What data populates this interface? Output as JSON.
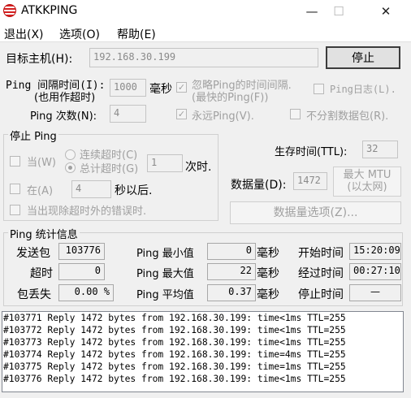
{
  "window": {
    "title": "ATKKPING",
    "minimize_glyph": "—",
    "maximize_glyph": "☐",
    "close_glyph": "✕"
  },
  "menu": {
    "exit": "退出(X)",
    "options": "选项(O)",
    "help": "帮助(E)"
  },
  "target": {
    "label": "目标主机(H):",
    "value": "192.168.30.199",
    "stop_button": "停止"
  },
  "interval": {
    "label_line1": "Ping 间隔时间(I):",
    "label_line2": "(也用作超时)",
    "value": "1000",
    "unit": "毫秒",
    "ignore_line1": "忽略Ping的时间间隔.",
    "ignore_line2": "(最快的Ping(F))",
    "ping_log": "Ping日志(L)."
  },
  "count": {
    "label": "Ping 次数(N):",
    "value": "4",
    "forever": "永远Ping(V).",
    "no_fragment": "不分割数据包(R)."
  },
  "stop_ping": {
    "group_title": "停止 Ping",
    "when": "当(W)",
    "consecutive_timeout": "连续超时(C)",
    "total_timeout": "总计超时(G)",
    "timeout_value": "1",
    "times": "次时.",
    "at": "在(A)",
    "at_value": "4",
    "seconds_after": "秒以后.",
    "on_error": "当出现除超时外的错误时."
  },
  "ttl": {
    "label": "生存时间(TTL):",
    "value": "32"
  },
  "data": {
    "label": "数据量(D):",
    "value": "1472",
    "max_mtu_line1": "最大 MTU",
    "max_mtu_line2": "(以太网)",
    "options_button": "数据量选项(Z)..."
  },
  "stats": {
    "group_title": "Ping  统计信息",
    "sent_label": "发送包",
    "sent_value": "103776",
    "timeout_label": "超时",
    "timeout_value": "0",
    "loss_label": "包丢失",
    "loss_value": "0.00 %",
    "min_label": "Ping 最小值",
    "min_value": "0",
    "max_label": "Ping 最大值",
    "max_value": "22",
    "avg_label": "Ping 平均值",
    "avg_value": "0.37",
    "ms_unit": "毫秒",
    "start_label": "开始时间",
    "start_value": "15:20:09",
    "elapsed_label": "经过时间",
    "elapsed_value": "00:27:10",
    "stop_label": "停止时间",
    "stop_value": "—"
  },
  "log": {
    "lines": [
      "#103771 Reply 1472 bytes from 192.168.30.199: time<1ms TTL=255",
      "#103772 Reply 1472 bytes from 192.168.30.199: time<1ms TTL=255",
      "#103773 Reply 1472 bytes from 192.168.30.199: time<1ms TTL=255",
      "#103774 Reply 1472 bytes from 192.168.30.199: time=4ms TTL=255",
      "#103775 Reply 1472 bytes from 192.168.30.199: time=1ms TTL=255",
      "#103776 Reply 1472 bytes from 192.168.30.199: time<1ms TTL=255"
    ]
  }
}
